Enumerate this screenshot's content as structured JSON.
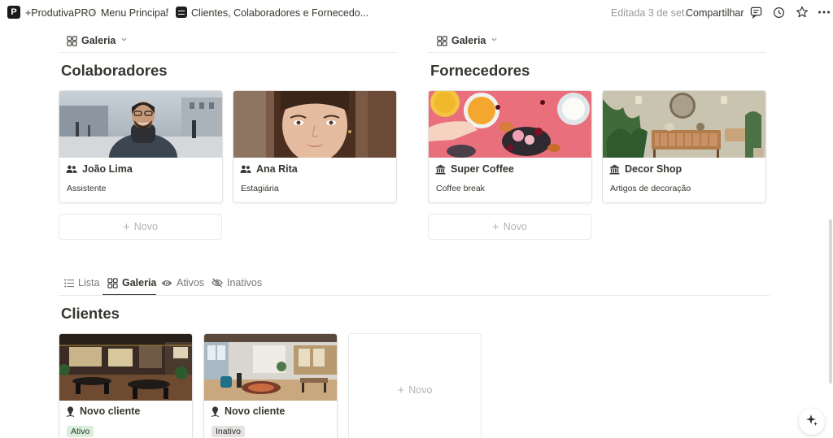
{
  "topbar": {
    "logo_letter": "P",
    "crumb_workspace": "+ProdutivaPRO",
    "crumb_menu": "Menu Principal",
    "crumb_page": "Clientes, Colaboradores e Fornecedo...",
    "separator": "/",
    "edited": "Editada 3 de set.",
    "share_label": "Compartilhar",
    "more_icon": "more-icon"
  },
  "colaboradores": {
    "view_label": "Galeria",
    "title": "Colaboradores",
    "cards": [
      {
        "name": "João Lima",
        "role": "Assistente"
      },
      {
        "name": "Ana Rita",
        "role": "Estagiária"
      }
    ],
    "new_label": "Novo"
  },
  "fornecedores": {
    "view_label": "Galeria",
    "title": "Fornecedores",
    "cards": [
      {
        "name": "Super Coffee",
        "role": "Coffee break"
      },
      {
        "name": "Decor Shop",
        "role": "Artigos de decoração"
      }
    ],
    "new_label": "Novo"
  },
  "clientes": {
    "tabs": [
      {
        "label": "Lista",
        "icon": "list-icon"
      },
      {
        "label": "Galeria",
        "icon": "gallery-icon",
        "active": true
      },
      {
        "label": "Ativos",
        "icon": "eye-icon"
      },
      {
        "label": "Inativos",
        "icon": "eye-off-icon"
      }
    ],
    "title": "Clientes",
    "cards": [
      {
        "name": "Novo cliente",
        "status": "Ativo"
      },
      {
        "name": "Novo cliente",
        "status": "Inativo"
      }
    ],
    "new_label": "Novo"
  },
  "colors": {
    "text": "#37352f",
    "muted": "#9b9a97",
    "tag_active_bg": "#dbeddb",
    "tag_active_text": "#1c3829",
    "tag_inactive_bg": "#e3e2e0",
    "tag_inactive_text": "#32302c"
  }
}
